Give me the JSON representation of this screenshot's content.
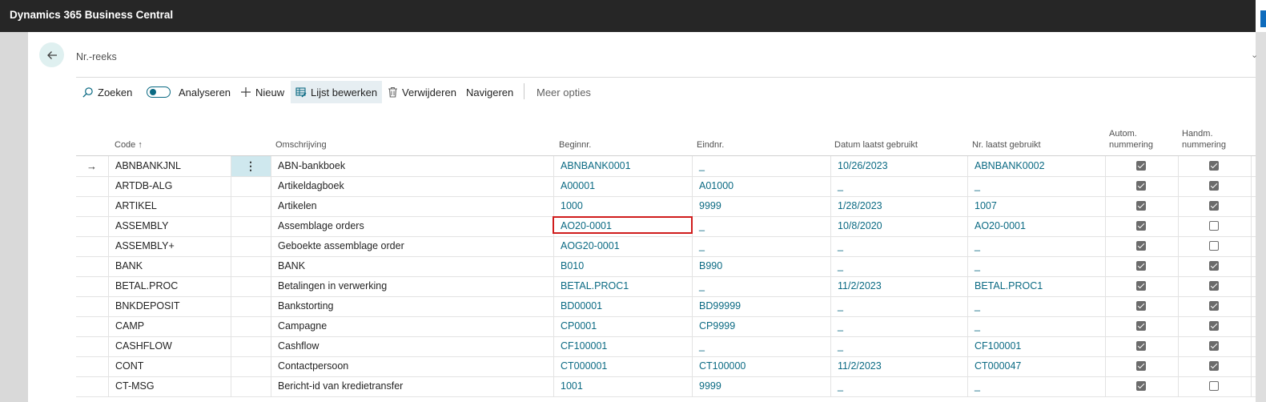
{
  "app": {
    "title": "Dynamics 365 Business Central"
  },
  "page": {
    "title": "Nr.-reeks"
  },
  "actions": {
    "search": "Zoeken",
    "analyze": "Analyseren",
    "new": "Nieuw",
    "edit_list": "Lijst bewerken",
    "delete": "Verwijderen",
    "navigate": "Navigeren",
    "more": "Meer opties"
  },
  "columns": {
    "code": "Code ↑",
    "description": "Omschrijving",
    "starting_no": "Beginnr.",
    "ending_no": "Eindnr.",
    "last_date_used": "Datum laatst gebruikt",
    "last_no_used": "Nr. laatst gebruikt",
    "default_nos_1": "Autom.",
    "default_nos_2": "nummering",
    "manual_nos_1": "Handm.",
    "manual_nos_2": "nummering"
  },
  "rows": [
    {
      "code": "ABNBANKJNL",
      "description": "ABN-bankboek",
      "starting_no": "ABNBANK0001",
      "ending_no": "_",
      "last_date_used": "10/26/2023",
      "last_no_used": "ABNBANK0002",
      "auto": true,
      "manual": true
    },
    {
      "code": "ARTDB-ALG",
      "description": "Artikeldagboek",
      "starting_no": "A00001",
      "ending_no": "A01000",
      "last_date_used": "_",
      "last_no_used": "_",
      "auto": true,
      "manual": true
    },
    {
      "code": "ARTIKEL",
      "description": "Artikelen",
      "starting_no": "1000",
      "ending_no": "9999",
      "last_date_used": "1/28/2023",
      "last_no_used": "1007",
      "auto": true,
      "manual": true
    },
    {
      "code": "ASSEMBLY",
      "description": "Assemblage orders",
      "starting_no": "AO20-0001",
      "ending_no": "_",
      "last_date_used": "10/8/2020",
      "last_no_used": "AO20-0001",
      "auto": true,
      "manual": false
    },
    {
      "code": "ASSEMBLY+",
      "description": "Geboekte assemblage order",
      "starting_no": "AOG20-0001",
      "ending_no": "_",
      "last_date_used": "_",
      "last_no_used": "_",
      "auto": true,
      "manual": false
    },
    {
      "code": "BANK",
      "description": "BANK",
      "starting_no": "B010",
      "ending_no": "B990",
      "last_date_used": "_",
      "last_no_used": "_",
      "auto": true,
      "manual": true
    },
    {
      "code": "BETAL.PROC",
      "description": "Betalingen in verwerking",
      "starting_no": "BETAL.PROC1",
      "ending_no": "_",
      "last_date_used": "11/2/2023",
      "last_no_used": "BETAL.PROC1",
      "auto": true,
      "manual": true
    },
    {
      "code": "BNKDEPOSIT",
      "description": "Bankstorting",
      "starting_no": "BD00001",
      "ending_no": "BD99999",
      "last_date_used": "_",
      "last_no_used": "_",
      "auto": true,
      "manual": true
    },
    {
      "code": "CAMP",
      "description": "Campagne",
      "starting_no": "CP0001",
      "ending_no": "CP9999",
      "last_date_used": "_",
      "last_no_used": "_",
      "auto": true,
      "manual": true
    },
    {
      "code": "CASHFLOW",
      "description": "Cashflow",
      "starting_no": "CF100001",
      "ending_no": "_",
      "last_date_used": "_",
      "last_no_used": "CF100001",
      "auto": true,
      "manual": true
    },
    {
      "code": "CONT",
      "description": "Contactpersoon",
      "starting_no": "CT000001",
      "ending_no": "CT100000",
      "last_date_used": "11/2/2023",
      "last_no_used": "CT000047",
      "auto": true,
      "manual": true
    },
    {
      "code": "CT-MSG",
      "description": "Bericht-id van kredietransfer",
      "starting_no": "1001",
      "ending_no": "9999",
      "last_date_used": "_",
      "last_no_used": "_",
      "auto": true,
      "manual": false
    }
  ],
  "colors": {
    "link": "#0b6a83",
    "topbar": "#262626",
    "highlight": "#d01c1c"
  }
}
